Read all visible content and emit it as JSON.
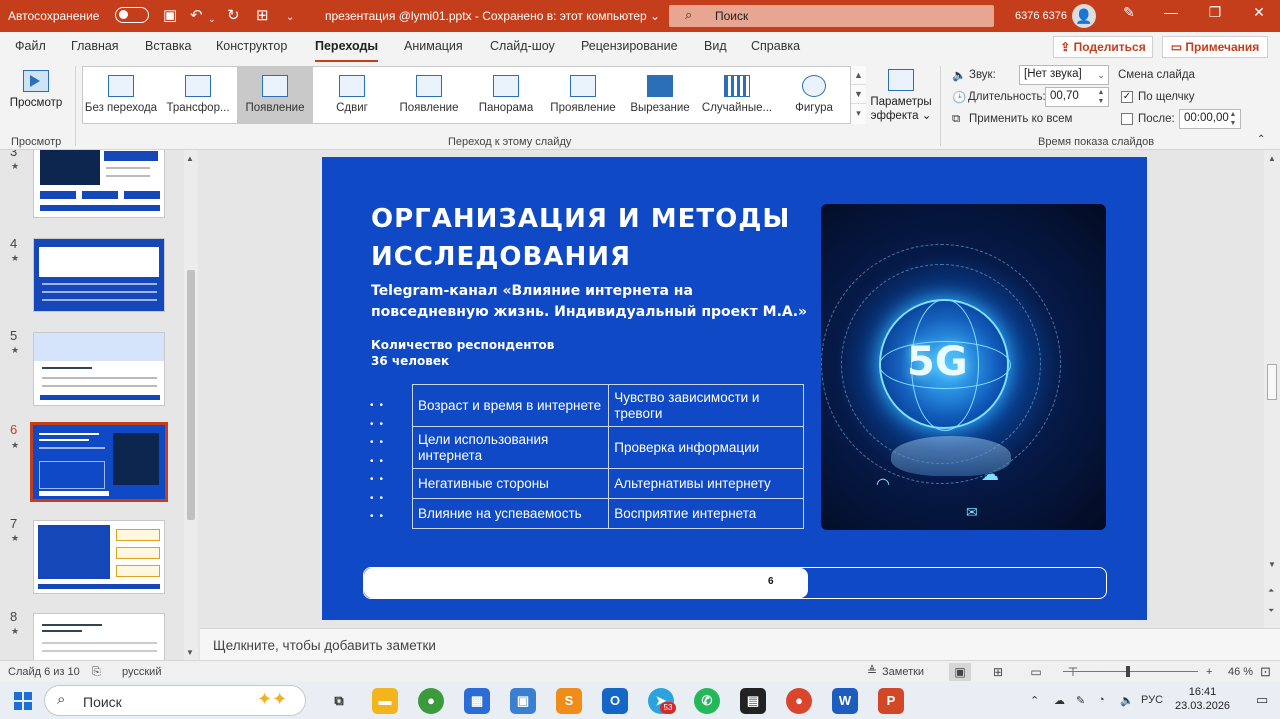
{
  "titlebar": {
    "autosave_label": "Автосохранение",
    "filename": "презентация @lymi01.pptx  -  Сохранено в: этот компьютер  ⌄",
    "search_placeholder": "Поиск",
    "user_name": "6376 6376"
  },
  "tabs": [
    "Файл",
    "Главная",
    "Вставка",
    "Конструктор",
    "Переходы",
    "Анимация",
    "Слайд-шоу",
    "Рецензирование",
    "Вид",
    "Справка"
  ],
  "active_tab": "Переходы",
  "share_label": "Поделиться",
  "comments_label": "Примечания",
  "ribbon": {
    "preview_label": "Просмотр",
    "preview_group": "Просмотр",
    "transitions": [
      {
        "label": "Без перехода",
        "icon": "no-transition-icon"
      },
      {
        "label": "Трансфор...",
        "icon": "morph-icon"
      },
      {
        "label": "Появление",
        "icon": "fade-icon",
        "selected": true
      },
      {
        "label": "Сдвиг",
        "icon": "push-icon"
      },
      {
        "label": "Появление",
        "icon": "wipe-icon"
      },
      {
        "label": "Панорама",
        "icon": "split-icon"
      },
      {
        "label": "Проявление",
        "icon": "reveal-icon"
      },
      {
        "label": "Вырезание",
        "icon": "cut-icon"
      },
      {
        "label": "Случайные...",
        "icon": "random-bars-icon"
      },
      {
        "label": "Фигура",
        "icon": "shape-icon"
      }
    ],
    "effect_options_label_1": "Параметры",
    "effect_options_label_2": "эффекта ⌄",
    "transition_group": "Переход к этому слайду",
    "sound_label": "Звук:",
    "sound_value": "[Нет звука]",
    "duration_label": "Длительность:",
    "duration_value": "00,70",
    "apply_all_label": "Применить ко всем",
    "advance_label": "Смена слайда",
    "on_click_label": "По щелчку",
    "on_click_checked": true,
    "after_label": "После:",
    "after_checked": false,
    "after_value": "00:00,00",
    "timing_group": "Время показа слайдов"
  },
  "thumbnails": [
    {
      "num": "3",
      "title": "ВВЕДЕНИЕ"
    },
    {
      "num": "4",
      "title": "ТЕОРЕТИЧЕСКИЕ АСПЕКТЫ: РОЛЬ ИНТЕРНЕТА"
    },
    {
      "num": "5",
      "title": "ПОЛОЖИТЕЛЬНЫЕ И ОТРИЦАТЕЛЬНЫЕ СТОРОНЫ"
    },
    {
      "num": "6",
      "title": "ОРГАНИЗАЦИЯ И МЕТОДЫ ИССЛЕДОВАНИЯ",
      "selected": true
    },
    {
      "num": "7",
      "title": "ЗАВИСИМОСТЬ И ВРЕМЯ: КЛЮЧЕВЫЕ ИНДИКАТОРЫ"
    },
    {
      "num": "8",
      "title": "ДЛЯ ЧЕГО МЫ ИСПОЛЬЗУЕМ ИНТЕРНЕТ?"
    }
  ],
  "slide": {
    "title": "ОРГАНИЗАЦИЯ И МЕТОДЫ ИССЛЕДОВАНИЯ",
    "subtitle": "Telegram-канал «Влияние интернета на повседневную жизнь. Индивидуальный проект М.А.»",
    "respondents_label": "Количество респондентов",
    "respondents_value": "36 человек",
    "table": [
      [
        "Возраст и время в интернете",
        "Чувство зависимости и тревоги"
      ],
      [
        "Цели использования интернета",
        "Проверка информации"
      ],
      [
        "Негативные стороны",
        "Альтернативы интернету"
      ],
      [
        "Влияние на успеваемость",
        "Восприятие интернета"
      ]
    ],
    "image_text": "5G",
    "page_number": "6",
    "progress_fraction": 0.6
  },
  "notes_placeholder": "Щелкните, чтобы добавить заметки",
  "status": {
    "slide_info": "Слайд 6 из 10",
    "language": "русский",
    "notes_label": "Заметки",
    "zoom": "46 %"
  },
  "taskbar": {
    "search_label": "Поиск",
    "apps": [
      {
        "name": "task-view-icon",
        "label": "⧉",
        "color": "#e9eef4"
      },
      {
        "name": "file-explorer-icon",
        "label": "▬",
        "color": "#f2b51d"
      },
      {
        "name": "chrome-icon",
        "label": "●",
        "color": "#3c9a3c"
      },
      {
        "name": "store-icon",
        "label": "▦",
        "color": "#2b6cd6"
      },
      {
        "name": "remote-desktop-icon",
        "label": "▣",
        "color": "#3a7fd0"
      },
      {
        "name": "sublime-icon",
        "label": "S",
        "color": "#f08c1a"
      },
      {
        "name": "outlook-icon",
        "label": "O",
        "color": "#1467c6"
      },
      {
        "name": "telegram-icon",
        "label": "➤",
        "color": "#2aa3df"
      },
      {
        "name": "whatsapp-icon",
        "label": "✆",
        "color": "#25b85a"
      },
      {
        "name": "notion-icon",
        "label": "▤",
        "color": "#222222"
      },
      {
        "name": "chrome-profile-icon",
        "label": "●",
        "color": "#d9462c"
      },
      {
        "name": "word-icon",
        "label": "W",
        "color": "#1f5cbf"
      },
      {
        "name": "powerpoint-icon",
        "label": "P",
        "color": "#d24726"
      }
    ],
    "telegram_badge": "53",
    "language": "РУС",
    "time": "16:41",
    "date": "23.03.2026"
  },
  "colors": {
    "accent": "#c43e1c",
    "slide_bg": "#0f49c6"
  }
}
